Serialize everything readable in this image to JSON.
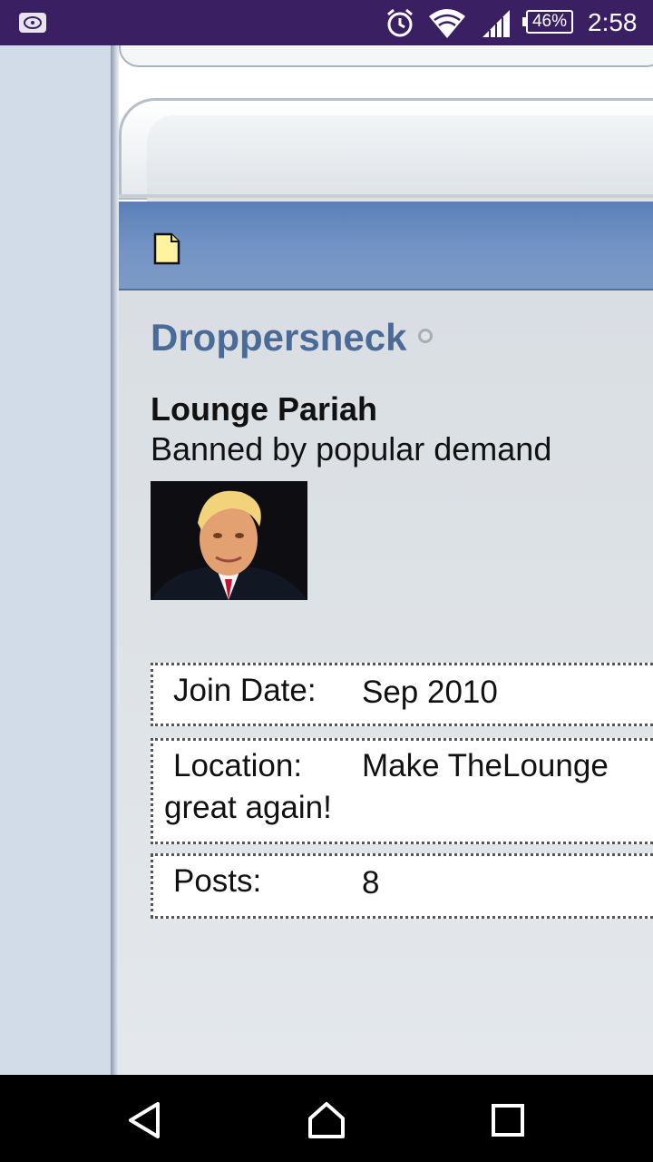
{
  "status_bar": {
    "battery": "46%",
    "time": "2:58",
    "icons": [
      "notification-icon",
      "alarm-icon",
      "wifi-icon",
      "cell-signal-icon",
      "battery-icon"
    ]
  },
  "profile": {
    "username": "Droppersneck",
    "user_title": "Lounge Pariah",
    "subtitle": "Banned by popular demand",
    "fields": {
      "join_date_label": "Join Date:",
      "join_date_value": "Sep 2010",
      "location_label": "Location:",
      "location_value_line1": "Make TheLounge",
      "location_value_line2": "great again!",
      "posts_label": "Posts:",
      "posts_value": "8"
    }
  },
  "colors": {
    "status_bar": "#3b1f63",
    "username": "#4a6a97",
    "blue_bar": "#6f8fc2"
  },
  "nav": {
    "buttons": [
      "back-icon",
      "home-icon",
      "recents-icon"
    ]
  }
}
